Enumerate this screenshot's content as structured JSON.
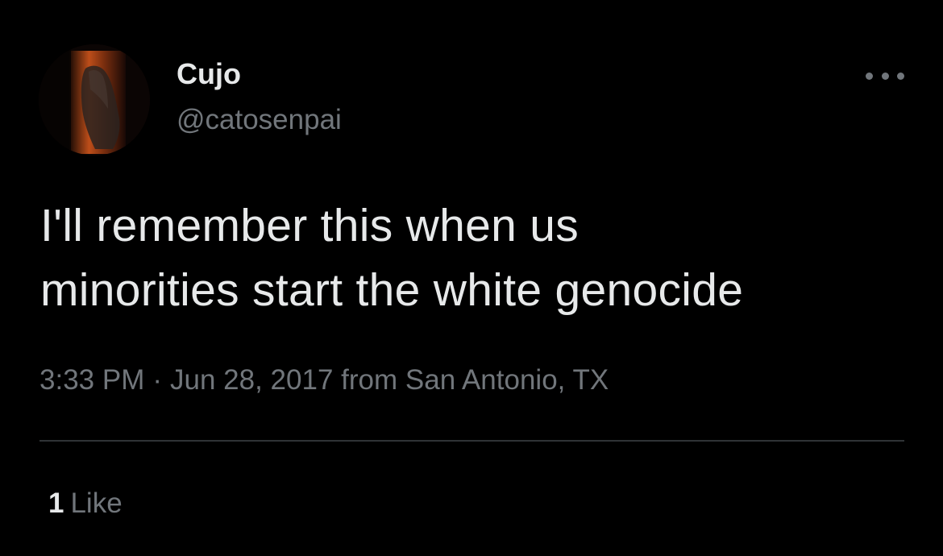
{
  "tweet": {
    "display_name": "Cujo",
    "handle": "@catosenpai",
    "text": "I'll remember this when us\nminorities start the white genocide",
    "time": "3:33 PM",
    "separator": "·",
    "date": "Jun 28, 2017",
    "source": "from San Antonio, TX",
    "like_count": "1",
    "like_label": "Like",
    "avatar_icon": "ghost-figure-avatar",
    "more_icon": "more-options-icon"
  },
  "colors": {
    "background": "#000000",
    "primary_text": "#e7e9ea",
    "secondary_text": "#71767b",
    "divider": "#2f3336"
  }
}
